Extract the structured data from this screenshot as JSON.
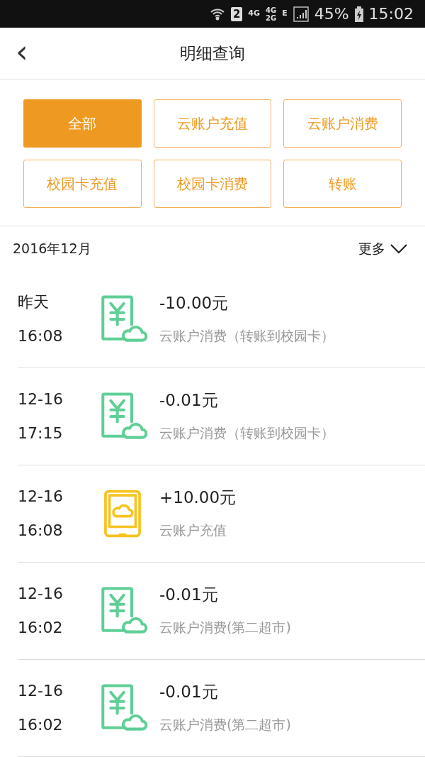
{
  "status_bar": {
    "sim": "2",
    "network_1": "4G",
    "network_2": "4G",
    "network_3": "2G",
    "network_4": "E",
    "battery": "45%",
    "time": "15:02"
  },
  "header": {
    "back": "‹",
    "title": "明细查询"
  },
  "filters": [
    {
      "label": "全部",
      "selected": true
    },
    {
      "label": "云账户充值",
      "selected": false
    },
    {
      "label": "云账户消费",
      "selected": false
    },
    {
      "label": "校园卡充值",
      "selected": false
    },
    {
      "label": "校园卡消费",
      "selected": false
    },
    {
      "label": "转账",
      "selected": false
    }
  ],
  "section": {
    "month": "2016年12月",
    "more": "更多"
  },
  "records": [
    {
      "date": "昨天",
      "time": "16:08",
      "kind": "payment",
      "amount": "-10.00元",
      "description": "云账户消费（转账到校园卡）"
    },
    {
      "date": "12-16",
      "time": "17:15",
      "kind": "payment",
      "amount": "-0.01元",
      "description": "云账户消费（转账到校园卡）"
    },
    {
      "date": "12-16",
      "time": "16:08",
      "kind": "topup",
      "amount": "+10.00元",
      "description": "云账户充值"
    },
    {
      "date": "12-16",
      "time": "16:02",
      "kind": "payment",
      "amount": "-0.01元",
      "description": "云账户消费(第二超市)"
    },
    {
      "date": "12-16",
      "time": "16:02",
      "kind": "payment",
      "amount": "-0.01元",
      "description": "云账户消费(第二超市)"
    }
  ]
}
